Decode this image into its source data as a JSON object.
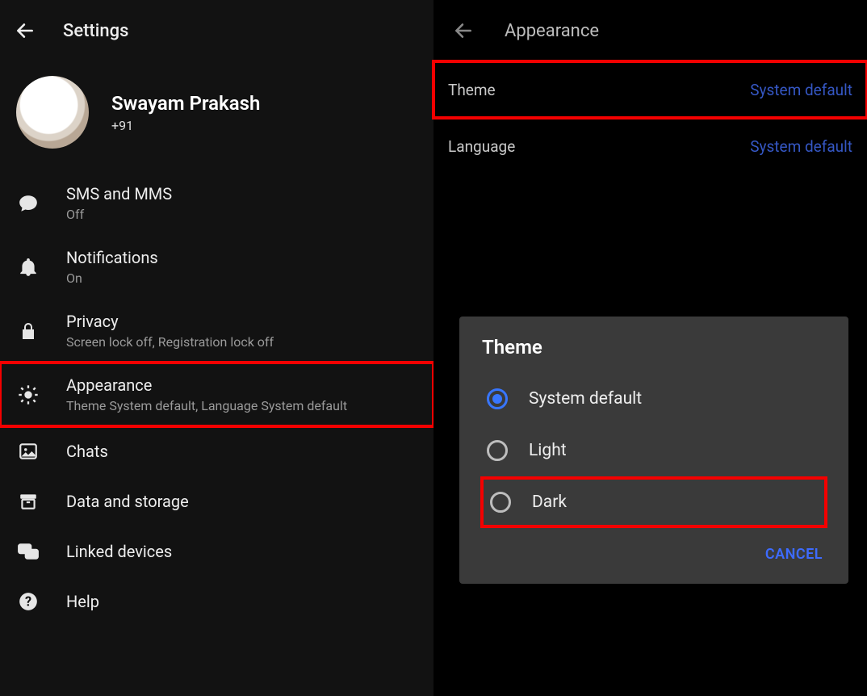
{
  "left": {
    "title": "Settings",
    "profile": {
      "name": "Swayam Prakash",
      "phone": "+91"
    },
    "items": {
      "sms": {
        "title": "SMS and MMS",
        "subtitle": "Off"
      },
      "notif": {
        "title": "Notifications",
        "subtitle": "On"
      },
      "privacy": {
        "title": "Privacy",
        "subtitle": "Screen lock off, Registration lock off"
      },
      "appearance": {
        "title": "Appearance",
        "subtitle": "Theme System default, Language System default"
      },
      "chats": {
        "title": "Chats"
      },
      "storage": {
        "title": "Data and storage"
      },
      "linked": {
        "title": "Linked devices"
      },
      "help": {
        "title": "Help"
      }
    }
  },
  "right": {
    "title": "Appearance",
    "rows": {
      "theme": {
        "key": "Theme",
        "val": "System default"
      },
      "language": {
        "key": "Language",
        "val": "System default"
      }
    },
    "dialog": {
      "title": "Theme",
      "options": {
        "system": "System default",
        "light": "Light",
        "dark": "Dark"
      },
      "cancel": "CANCEL"
    }
  }
}
